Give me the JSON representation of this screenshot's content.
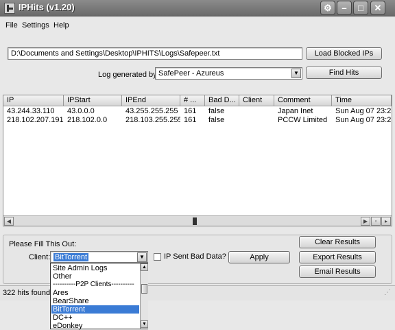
{
  "window": {
    "title": "IPHits (v1.20)"
  },
  "menu": [
    "File",
    "Settings",
    "Help"
  ],
  "top": {
    "path_value": "D:\\Documents and Settings\\Desktop\\IPHITS\\Logs\\Safepeer.txt",
    "load_button": "Load Blocked IPs",
    "log_label": "Log generated by",
    "log_value": "SafePeer - Azureus",
    "find_button": "Find Hits"
  },
  "table": {
    "columns": [
      "IP",
      "IPStart",
      "IPEnd",
      "# ...",
      "Bad D...",
      "Client",
      "Comment",
      "Time"
    ],
    "rows": [
      [
        "43.244.33.110",
        "43.0.0.0",
        "43.255.255.255",
        "161",
        "false",
        "",
        "Japan Inet",
        "Sun Aug 07 23:2..."
      ],
      [
        "218.102.207.191",
        "218.102.0.0",
        "218.103.255.255",
        "161",
        "false",
        "",
        "PCCW Limited",
        "Sun Aug 07 23:2..."
      ]
    ]
  },
  "form": {
    "fill_label": "Please Fill This Out:",
    "client_label": "Client:",
    "client_value": "BitTorrent",
    "bad_data_label": "IP Sent Bad Data?",
    "apply_button": "Apply",
    "clear_button": "Clear Results",
    "export_button": "Export Results",
    "email_button": "Email Results"
  },
  "dropdown": {
    "options": [
      "Site Admin Logs",
      "Other",
      "----------P2P Clients----------",
      "Ares",
      "BearShare",
      "BitTorrent",
      "DC++",
      "eDonkey"
    ],
    "selected_index": 5
  },
  "status": {
    "text": "322 hits found. D"
  }
}
